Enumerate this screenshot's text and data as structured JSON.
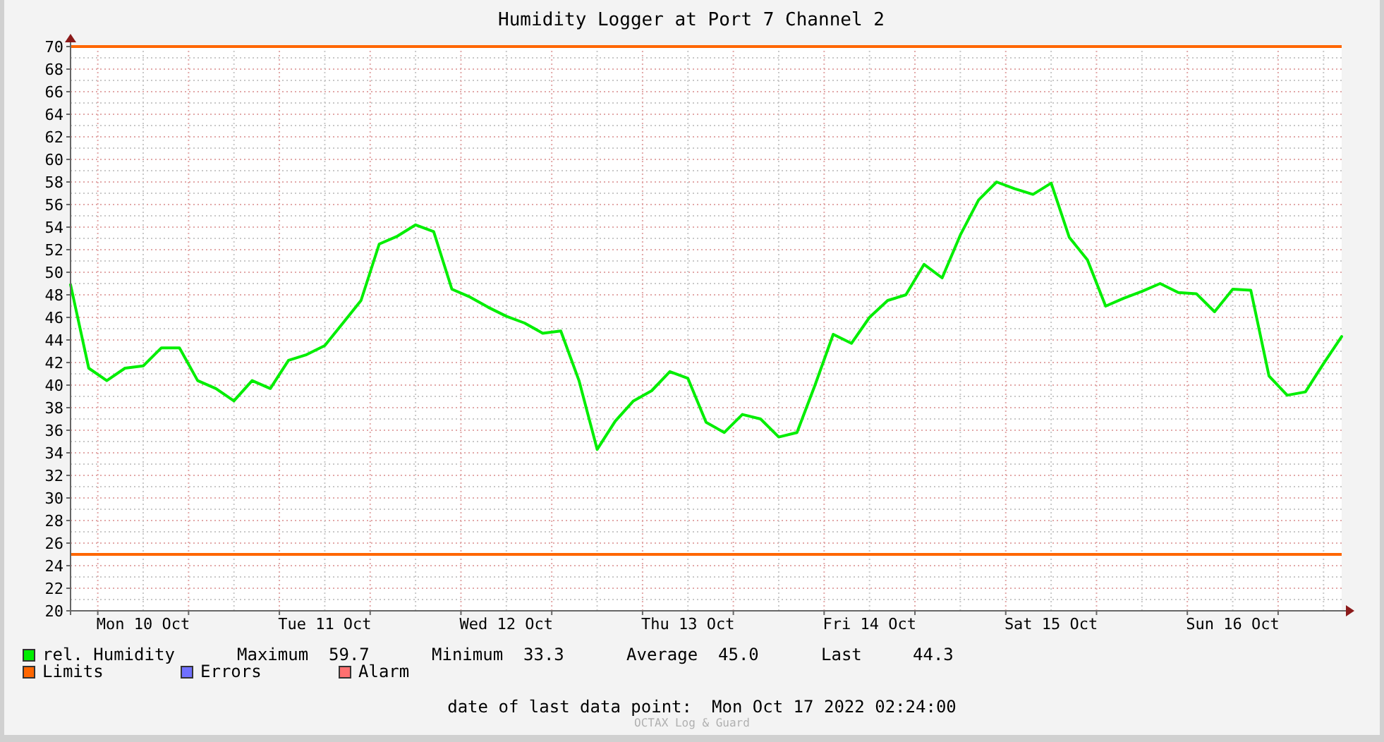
{
  "title": "Humidity Logger at Port 7 Channel 2",
  "chart_data": {
    "type": "line",
    "ylim": [
      20,
      70
    ],
    "yticks": [
      20,
      22,
      24,
      26,
      28,
      30,
      32,
      34,
      36,
      38,
      40,
      42,
      44,
      46,
      48,
      50,
      52,
      54,
      56,
      58,
      60,
      62,
      64,
      66,
      68,
      70
    ],
    "categories": [
      null,
      null,
      null,
      null,
      "Mon 10 Oct",
      null,
      null,
      null,
      null,
      null,
      null,
      null,
      null,
      null,
      "Tue 11 Oct",
      null,
      null,
      null,
      null,
      null,
      null,
      null,
      null,
      null,
      "Wed 12 Oct",
      null,
      null,
      null,
      null,
      null,
      null,
      null,
      null,
      null,
      "Thu 13 Oct",
      null,
      null,
      null,
      null,
      null,
      null,
      null,
      null,
      null,
      "Fri 14 Oct",
      null,
      null,
      null,
      null,
      null,
      null,
      null,
      null,
      null,
      "Sat 15 Oct",
      null,
      null,
      null,
      null,
      null,
      null,
      null,
      null,
      null,
      "Sun 16 Oct",
      null,
      null,
      null,
      null,
      null,
      null
    ],
    "series": [
      {
        "name": "rel. Humidity",
        "color": "#00ee00",
        "values": [
          48.9,
          41.5,
          40.4,
          41.5,
          41.7,
          43.3,
          43.3,
          40.4,
          39.7,
          38.6,
          40.4,
          39.7,
          42.2,
          42.7,
          43.5,
          45.5,
          47.5,
          52.5,
          53.2,
          54.2,
          53.6,
          48.5,
          47.8,
          46.9,
          46.1,
          45.5,
          44.6,
          44.8,
          40.4,
          34.3,
          36.8,
          38.6,
          39.5,
          41.2,
          40.6,
          36.7,
          35.8,
          37.4,
          37.0,
          35.4,
          35.8,
          40.0,
          44.5,
          43.7,
          46.0,
          47.5,
          48.0,
          50.7,
          49.5,
          53.3,
          56.4,
          58.0,
          57.4,
          56.9,
          57.9,
          53.1,
          51.1,
          47.0,
          47.7,
          48.3,
          49.0,
          48.2,
          48.1,
          46.5,
          48.5,
          48.4,
          40.8,
          39.1,
          39.4,
          41.9,
          44.3
        ]
      }
    ],
    "grid": true,
    "ref_lines": [
      {
        "axis": "y",
        "value": 70,
        "color": "#ff6600"
      },
      {
        "axis": "y",
        "value": 25,
        "color": "#ff6600"
      }
    ]
  },
  "legend": [
    {
      "stats": [
        {
          "label": "Maximum",
          "value": "59.7"
        },
        {
          "label": "Minimum",
          "value": "33.3"
        },
        {
          "label": "Average",
          "value": "45.0"
        },
        {
          "label": "Last",
          "value": "44.3"
        }
      ]
    },
    {
      "label": "Limits",
      "color": "#ff6600"
    },
    {
      "label": "Errors",
      "color": "#7070ff"
    },
    {
      "label": "Alarm",
      "color": "#ff7070"
    }
  ],
  "last_data_point": {
    "label": "date of last data point:",
    "value": "Mon Oct 17 2022 02:24:00"
  },
  "credit": "OCTAX Log & Guard"
}
